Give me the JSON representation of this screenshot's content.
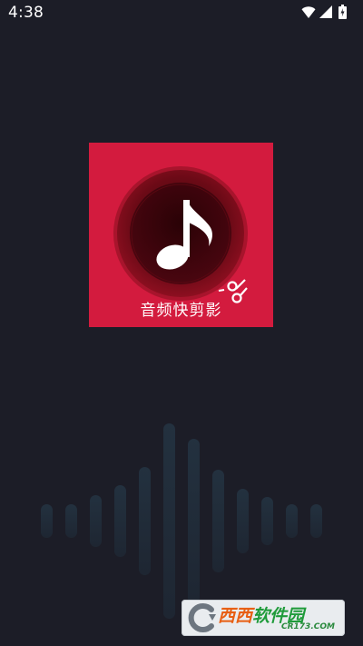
{
  "status_bar": {
    "time": "4:38",
    "icons": [
      "wifi-icon",
      "signal-icon",
      "battery-icon"
    ]
  },
  "splash": {
    "app_name": "音频快剪影",
    "tile_color": "#d31b3e",
    "icons": [
      "music-note-icon",
      "scissors-icon"
    ]
  },
  "background_color": "#1c1d27",
  "watermark": {
    "brand_part1": "西西",
    "brand_part2": "软件园",
    "domain": "CR173.COM",
    "icon": "cr-logo-icon"
  }
}
